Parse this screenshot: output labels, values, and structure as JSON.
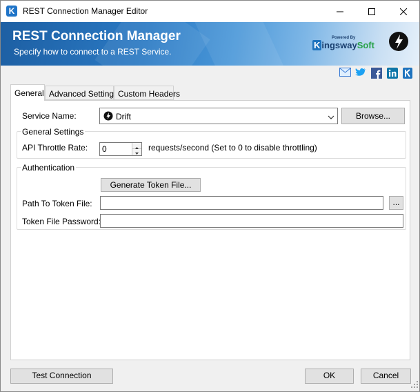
{
  "window": {
    "title": "REST Connection Manager Editor"
  },
  "banner": {
    "title": "REST Connection Manager",
    "subtitle": "Specify how to connect to a REST Service.",
    "logo_powered": "Powered By",
    "logo_k": "K",
    "logo_ingsway": "ingsway",
    "logo_soft": "Soft"
  },
  "social_icons": [
    "mail-icon",
    "twitter-icon",
    "facebook-icon",
    "linkedin-icon",
    "kingswaysoft-icon"
  ],
  "tabs": [
    {
      "label": "General",
      "active": true
    },
    {
      "label": "Advanced Settings",
      "active": false
    },
    {
      "label": "Custom Headers",
      "active": false
    }
  ],
  "general": {
    "service_name_label": "Service Name:",
    "service_name_value": "Drift",
    "browse_label": "Browse...",
    "settings_group_label": "General Settings",
    "throttle_label": "API Throttle Rate:",
    "throttle_value": "0",
    "throttle_hint": "requests/second (Set to 0 to disable throttling)",
    "auth_group_label": "Authentication",
    "generate_token_label": "Generate Token File...",
    "path_label": "Path To Token File:",
    "path_value": "",
    "ellipsis_label": "...",
    "password_label": "Token File Password:",
    "password_value": ""
  },
  "footer": {
    "test_label": "Test Connection",
    "ok_label": "OK",
    "cancel_label": "Cancel"
  },
  "colors": {
    "banner_dark": "#1d5fa3",
    "accent_blue": "#1e73be",
    "kingsway_green": "#2aa24a"
  }
}
